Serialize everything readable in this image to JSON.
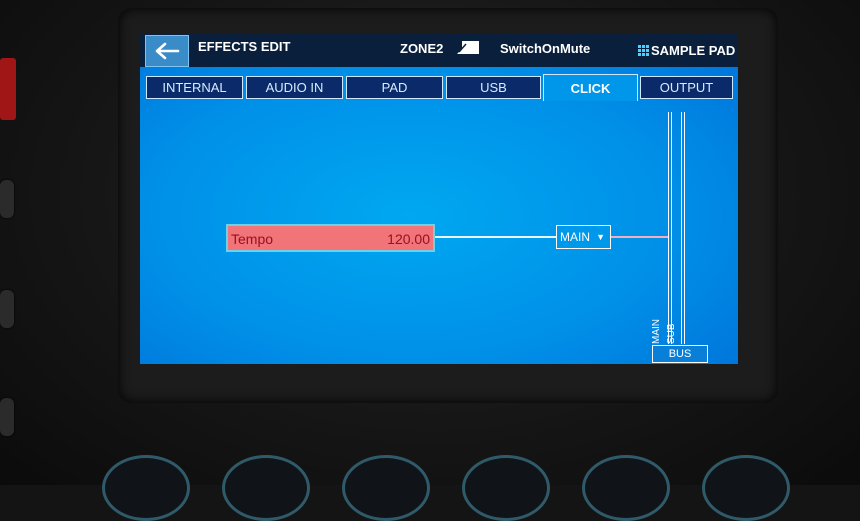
{
  "header": {
    "title": "EFFECTS EDIT",
    "zone": "ZONE2",
    "kit_name": "SwitchOnMute",
    "pad_mode": "SAMPLE PAD"
  },
  "tabs": [
    {
      "label": "INTERNAL",
      "active": false
    },
    {
      "label": "AUDIO IN",
      "active": false
    },
    {
      "label": "PAD",
      "active": false
    },
    {
      "label": "USB",
      "active": false
    },
    {
      "label": "CLICK",
      "active": true
    },
    {
      "label": "OUTPUT",
      "active": false
    }
  ],
  "click": {
    "param_label": "Tempo",
    "param_value": "120.00",
    "output_select": "MAIN"
  },
  "bus": {
    "label": "BUS",
    "main_label": "MAIN",
    "sub_label": "SUB"
  },
  "colors": {
    "screen_bg": "#0090e8",
    "topbar_bg": "#0a1f3c",
    "tempo_fill": "#f07478",
    "tempo_text": "#9a0f22"
  }
}
